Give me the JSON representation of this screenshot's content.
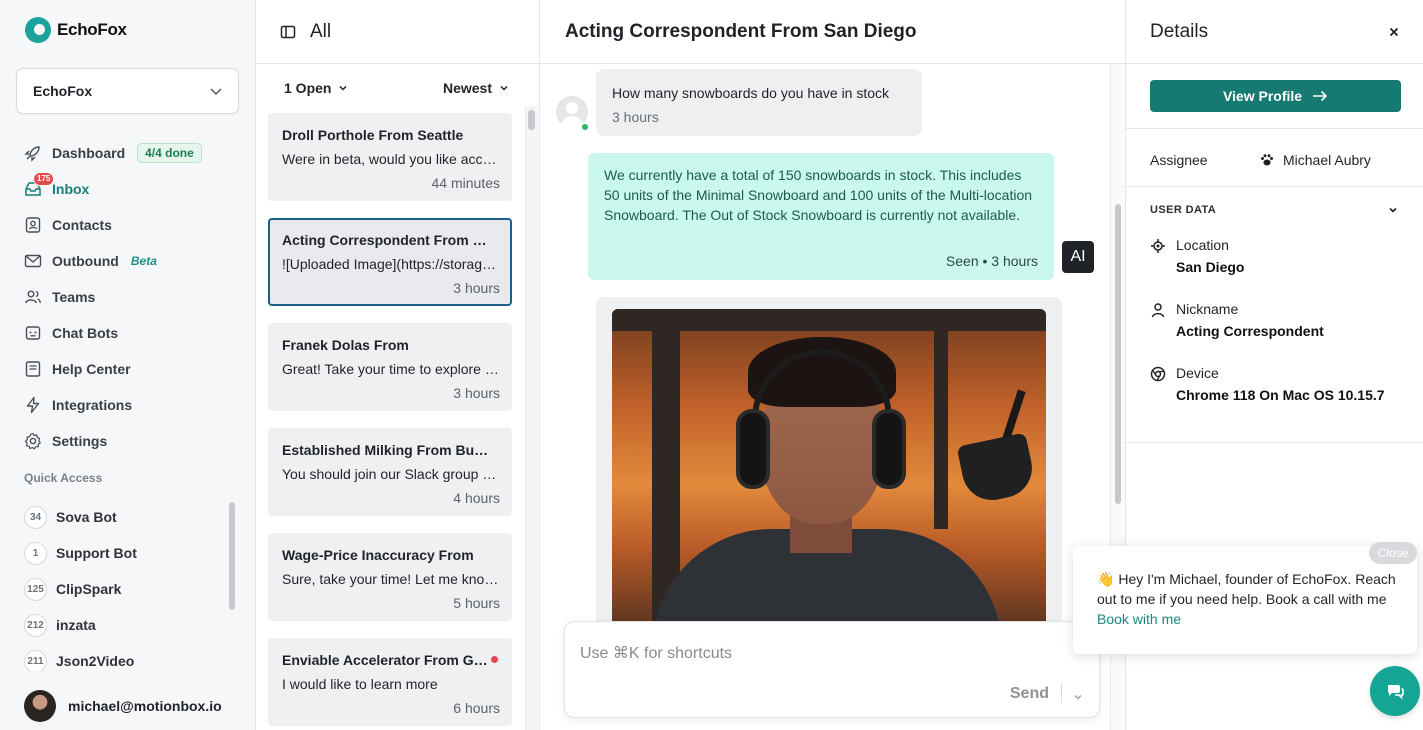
{
  "app": {
    "name": "EchoFox"
  },
  "workspace": {
    "name": "EchoFox"
  },
  "sidebar": {
    "items": [
      {
        "label": "Dashboard",
        "badge": "4/4 done"
      },
      {
        "label": "Inbox",
        "count": "175"
      },
      {
        "label": "Contacts"
      },
      {
        "label": "Outbound",
        "tag": "Beta"
      },
      {
        "label": "Teams"
      },
      {
        "label": "Chat Bots"
      },
      {
        "label": "Help Center"
      },
      {
        "label": "Integrations"
      },
      {
        "label": "Settings"
      }
    ],
    "quick_access_title": "Quick Access",
    "quick_access": [
      {
        "count": "34",
        "label": "Sova Bot"
      },
      {
        "count": "1",
        "label": "Support Bot"
      },
      {
        "count": "125",
        "label": "ClipSpark"
      },
      {
        "count": "212",
        "label": "inzata"
      },
      {
        "count": "211",
        "label": "Json2Video"
      }
    ],
    "user_email": "michael@motionbox.io"
  },
  "list": {
    "title": "All",
    "filter_open": "1 Open",
    "sort": "Newest",
    "conversations": [
      {
        "title": "Droll Porthole From Seattle",
        "preview": "Were in beta, would you like access?",
        "time": "44 minutes"
      },
      {
        "title": "Acting Correspondent From San Diego",
        "preview": "![Uploaded Image](https://storage.example)",
        "time": "3 hours"
      },
      {
        "title": "Franek Dolas From",
        "preview": "Great! Take your time to explore the app.",
        "time": "3 hours"
      },
      {
        "title": "Established Milking From Burlington",
        "preview": "You should join our Slack group for updates",
        "time": "4 hours"
      },
      {
        "title": "Wage-Price Inaccuracy From",
        "preview": "Sure, take your time! Let me know if you need",
        "time": "5 hours"
      },
      {
        "title": "Enviable Accelerator From Germany",
        "preview": "I would like to learn more",
        "time": "6 hours"
      }
    ]
  },
  "chat": {
    "title": "Acting Correspondent From San Diego",
    "incoming": {
      "text": "How many snowboards do you have in stock",
      "time": "3 hours"
    },
    "outgoing": {
      "text": "We currently have a total of 150 snowboards in stock. This includes 50 units of the Minimal Snowboard and 100 units of the Multi-location Snowboard. The Out of Stock Snowboard is currently not available.",
      "status": "Seen • 3 hours"
    },
    "ai_badge": "AI",
    "composer_placeholder": "Use ⌘K for shortcuts",
    "send_label": "Send"
  },
  "details": {
    "title": "Details",
    "view_profile": "View Profile",
    "assignee_label": "Assignee",
    "assignee_name": "Michael Aubry",
    "user_data_title": "USER DATA",
    "fields": [
      {
        "label": "Location",
        "value": "San Diego"
      },
      {
        "label": "Nickname",
        "value": "Acting Correspondent"
      },
      {
        "label": "Device",
        "value": "Chrome 118 On Mac OS 10.15.7"
      }
    ]
  },
  "widget": {
    "close_label": "Close",
    "emoji": "👋",
    "message": "Hey I'm Michael, founder of EchoFox. Reach out to me if you need help. Book a call with me",
    "link": "Book with me"
  },
  "colors": {
    "accent": "#167a72",
    "outgoing_bubble": "#cbf8ec",
    "unread": "#e5484d"
  }
}
